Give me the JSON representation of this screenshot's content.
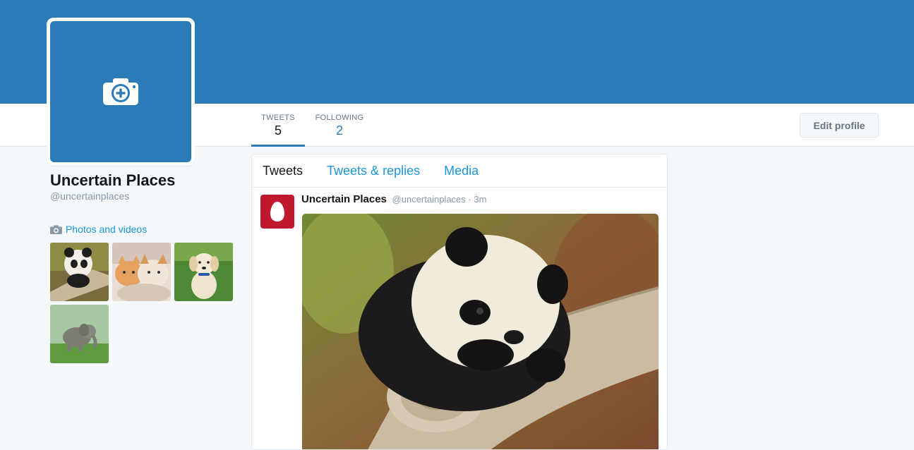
{
  "colors": {
    "banner": "#2b7bb9",
    "avatar_bg": "#2b7bb9",
    "link": "#1b95e0",
    "tweet_avatar": "#c0192f"
  },
  "profile": {
    "name": "Uncertain Places",
    "handle": "@uncertainplaces",
    "avatar_icon": "camera-plus-icon"
  },
  "stats": {
    "tweets_label": "TWEETS",
    "tweets_value": "5",
    "following_label": "FOLLOWING",
    "following_value": "2"
  },
  "actions": {
    "edit_profile": "Edit profile"
  },
  "sidebar": {
    "photos_link": "Photos and videos",
    "photos_icon": "camera-icon",
    "thumbnails": [
      "panda",
      "kittens",
      "puppy",
      "elephant"
    ]
  },
  "timeline": {
    "tabs": [
      {
        "label": "Tweets",
        "active": true
      },
      {
        "label": "Tweets & replies",
        "active": false
      },
      {
        "label": "Media",
        "active": false
      }
    ],
    "tweet": {
      "name": "Uncertain Places",
      "handle": "@uncertainplaces",
      "separator": "·",
      "time": "3m",
      "avatar_icon": "egg-icon",
      "media": "panda-photo"
    }
  }
}
